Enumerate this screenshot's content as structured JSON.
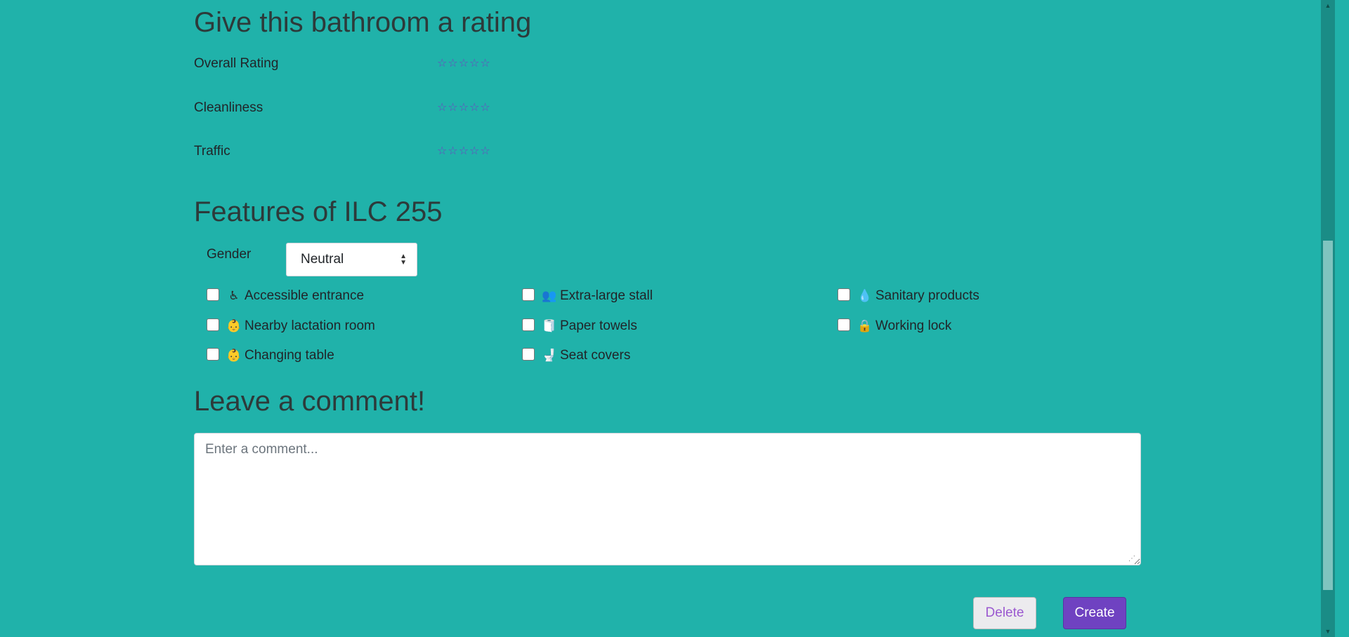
{
  "rating_section": {
    "title": "Give this bathroom a rating",
    "rows": [
      {
        "label": "Overall Rating",
        "stars": "☆☆☆☆☆",
        "value": 0
      },
      {
        "label": "Cleanliness",
        "stars": "☆☆☆☆☆",
        "value": 0
      },
      {
        "label": "Traffic",
        "stars": "☆☆☆☆☆",
        "value": 0
      }
    ]
  },
  "features_section": {
    "title": "Features of ILC 255",
    "gender_label": "Gender",
    "gender_value": "Neutral",
    "features": [
      {
        "label": "Accessible entrance",
        "icon": "wheelchair-icon",
        "glyph": "♿",
        "checked": false
      },
      {
        "label": "Extra-large stall",
        "icon": "users-icon",
        "glyph": "👥",
        "checked": false
      },
      {
        "label": "Sanitary products",
        "icon": "droplet-icon",
        "glyph": "💧",
        "checked": false
      },
      {
        "label": "Nearby lactation room",
        "icon": "baby-icon",
        "glyph": "👶",
        "checked": false
      },
      {
        "label": "Paper towels",
        "icon": "toilet-paper-icon",
        "glyph": "🧻",
        "checked": false
      },
      {
        "label": "Working lock",
        "icon": "user-lock-icon",
        "glyph": "🔒",
        "checked": false
      },
      {
        "label": "Changing table",
        "icon": "baby-icon",
        "glyph": "👶",
        "checked": false
      },
      {
        "label": "Seat covers",
        "icon": "toilet-icon",
        "glyph": "🚽",
        "checked": false
      }
    ]
  },
  "comment_section": {
    "title": "Leave a comment!",
    "placeholder": "Enter a comment..."
  },
  "buttons": {
    "delete_label": "Delete",
    "create_label": "Create"
  },
  "colors": {
    "background": "#20b2aa",
    "accent": "#6f42c1"
  }
}
